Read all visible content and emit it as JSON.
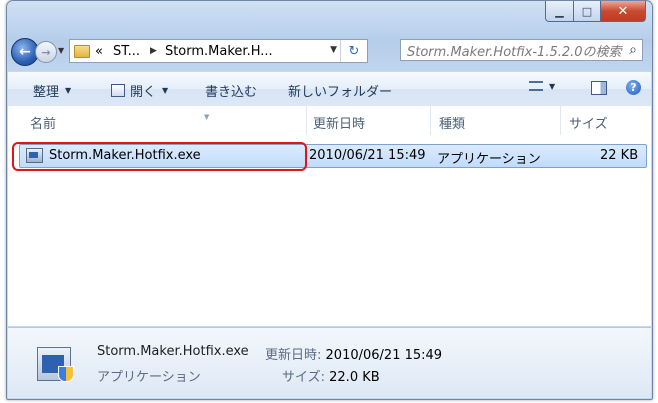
{
  "window": {
    "caption_buttons": {
      "minimize_icon": "minimize-icon",
      "maximize_icon": "maximize-icon",
      "close_icon": "close-icon"
    }
  },
  "nav": {
    "address_segments": [
      "«",
      "ST...",
      "Storm.Maker.H..."
    ],
    "search_placeholder": "Storm.Maker.Hotfix-1.5.2.0の検索"
  },
  "toolbar": {
    "organize": "整理",
    "open": "開く",
    "burn": "書き込む",
    "new_folder": "新しいフォルダー"
  },
  "columns": {
    "name": "名前",
    "modified": "更新日時",
    "type": "種類",
    "size": "サイズ"
  },
  "files": [
    {
      "name": "Storm.Maker.Hotfix.exe",
      "modified": "2010/06/21 15:49",
      "type": "アプリケーション",
      "size": "22 KB",
      "selected": true
    }
  ],
  "details": {
    "name": "Storm.Maker.Hotfix.exe",
    "modified_label": "更新日時:",
    "modified_value": "2010/06/21 15:49",
    "type": "アプリケーション",
    "size_label": "サイズ:",
    "size_value": "22.0 KB"
  },
  "colors": {
    "highlight": "#e01515",
    "selection": "#c1dbfc",
    "close_button": "#c94a31"
  }
}
